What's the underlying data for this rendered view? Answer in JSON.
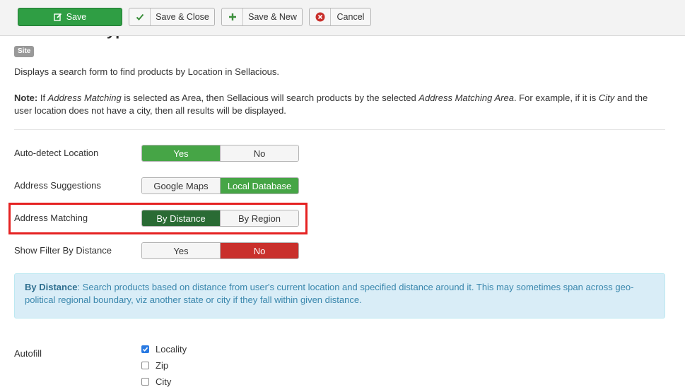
{
  "toolbar": {
    "save_label": "Save",
    "save_close_label": "Save & Close",
    "save_new_label": "Save & New",
    "cancel_label": "Cancel"
  },
  "module": {
    "title": "Sellacious Hyperlocal",
    "badge": "Site",
    "description": "Displays a search form to find products by Location in Sellacious.",
    "note": {
      "label": "Note:",
      "t1": " If ",
      "i1": "Address Matching",
      "t2": " is selected as Area, then Sellacious will search products by the selected ",
      "i2": "Address Matching Area",
      "t3": ". For example, if it is ",
      "i3": "City",
      "t4": " and the user location does not have a city, then all results will be displayed."
    }
  },
  "fields": {
    "auto_detect": {
      "label": "Auto-detect Location",
      "options": [
        "Yes",
        "No"
      ],
      "selected": "Yes"
    },
    "suggestions": {
      "label": "Address Suggestions",
      "options": [
        "Google Maps",
        "Local Database"
      ],
      "selected": "Local Database"
    },
    "matching": {
      "label": "Address Matching",
      "options": [
        "By Distance",
        "By Region"
      ],
      "selected": "By Distance"
    },
    "filter_distance": {
      "label": "Show Filter By Distance",
      "options": [
        "Yes",
        "No"
      ],
      "selected": "No"
    }
  },
  "info": {
    "term": "By Distance",
    "text": ": Search products based on distance from user's current location and specified distance around it. This may sometimes span across geo-political regional boundary, viz another state or city if they fall within given distance."
  },
  "autofill": {
    "label": "Autofill",
    "options": [
      {
        "label": "Locality",
        "checked": true
      },
      {
        "label": "Zip",
        "checked": false
      },
      {
        "label": "City",
        "checked": false
      }
    ]
  },
  "colors": {
    "save_green": "#2f9e44",
    "toggle_green": "#46a546",
    "toggle_dark_green": "#2a6b34",
    "toggle_red": "#c9302c",
    "highlight_red": "#e52222",
    "info_bg": "#d9edf7"
  }
}
